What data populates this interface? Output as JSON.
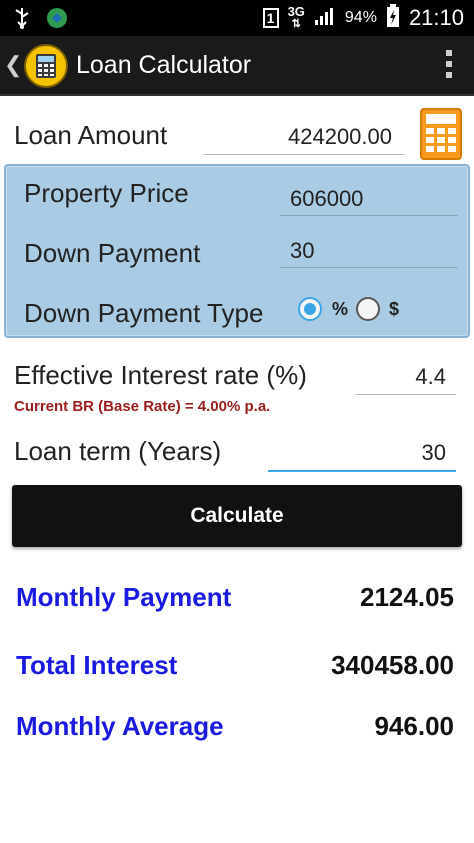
{
  "status_bar": {
    "network": "3G",
    "battery": "94%",
    "time": "21:10",
    "sim_slot": "1",
    "icons": [
      "usb-icon",
      "app-notification-icon",
      "sim-icon",
      "network-3g-icon",
      "signal-icon",
      "battery-charging-icon"
    ]
  },
  "action_bar": {
    "title": "Loan Calculator",
    "icons": [
      "back-icon",
      "app-logo-icon",
      "overflow-menu-icon"
    ]
  },
  "form": {
    "loan_amount": {
      "label": "Loan Amount",
      "value": "424200.00"
    },
    "property_price": {
      "label": "Property Price",
      "value": "606000"
    },
    "down_payment": {
      "label": "Down Payment",
      "value": "30"
    },
    "down_payment_type": {
      "label": "Down Payment Type",
      "options": [
        "%",
        "$"
      ],
      "selected": "%"
    },
    "interest_rate": {
      "label": "Effective Interest rate (%)",
      "value": "4.4"
    },
    "base_rate_note": "Current BR (Base Rate) = 4.00% p.a.",
    "loan_term": {
      "label": "Loan term (Years)",
      "value": "30"
    },
    "calculate_label": "Calculate"
  },
  "results": {
    "monthly_payment": {
      "label": "Monthly Payment",
      "value": "2124.05"
    },
    "total_interest": {
      "label": "Total Interest",
      "value": "340458.00"
    },
    "monthly_average": {
      "label": "Monthly Average",
      "value": "946.00"
    }
  },
  "colors": {
    "accent_blue": "#3aa6e8",
    "panel_blue": "#a9cbe3",
    "result_label_blue": "#1a1ae0",
    "note_red": "#9b1c1c",
    "calculator_orange": "#f59a1b"
  }
}
